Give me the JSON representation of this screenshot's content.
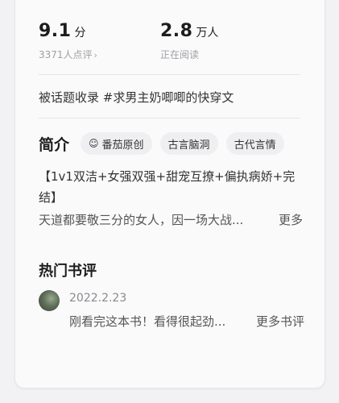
{
  "stats": {
    "rating": {
      "value": "9.1",
      "unit": "分",
      "sub": "3371人点评",
      "chevron": "›"
    },
    "readers": {
      "value": "2.8",
      "unit": "万人",
      "sub": "正在阅读"
    }
  },
  "topic": "被话题收录 #求男主奶唧唧的快穿文",
  "intro": {
    "title": "简介",
    "tags": [
      {
        "label": "番茄原创",
        "icon": "☺"
      },
      {
        "label": "古言脑洞"
      },
      {
        "label": "古代言情"
      }
    ],
    "desc_line1": "【1v1双洁+女强双强+甜宠互撩+偏执病娇+完",
    "desc_line2": "结】",
    "excerpt": "天道都要敬三分的女人，因一场大战...",
    "more": "更多"
  },
  "hot_reviews": {
    "title": "热门书评",
    "item": {
      "date": "2022.2.23",
      "text": "刚看完这本书！看得很起劲...",
      "more": "更多书评"
    }
  },
  "colors": {
    "page_bg": "#f2f2f4",
    "card_bg": "#fafafb",
    "tag_bg": "#efeff2",
    "muted": "#a0a0a5"
  }
}
